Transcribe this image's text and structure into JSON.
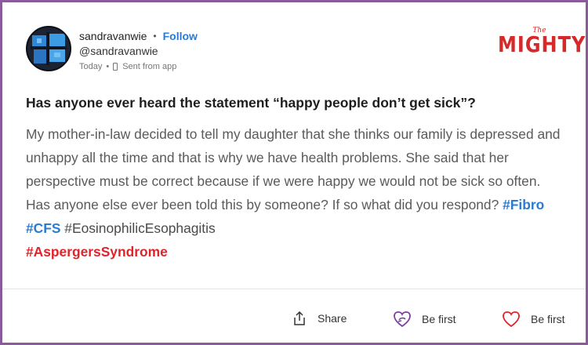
{
  "author": {
    "username": "sandravanwie",
    "follow_label": "Follow",
    "handle": "@sandravanwie",
    "time": "Today",
    "source": "Sent from app"
  },
  "brand": {
    "small": "The",
    "big": "MIGHTY",
    "color": "#d62a2a"
  },
  "post": {
    "title": "Has anyone ever heard the statement “happy people don’t get sick”?",
    "body": "My mother-in-law decided to tell my daughter that she thinks our family is depressed and unhappy all the time and that is why we have health problems. She said that her perspective must be correct because if we were happy we would not be sick so often. Has anyone else ever been told this by someone? If so what did you respond? ",
    "tags": [
      {
        "text": "#Fibro",
        "color": "#2a7bd1"
      },
      {
        "text": "#CFS",
        "color": "#2a7bd1"
      },
      {
        "text": "#EosinophilicEsophagitis",
        "color": "#4a4a4a"
      },
      {
        "text": "#AspergersSyndrome",
        "color": "#e2232a"
      }
    ]
  },
  "actions": {
    "share_label": "Share",
    "hug_label": "Be first",
    "like_label": "Be first"
  },
  "colors": {
    "frame": "#8b5a9a",
    "link": "#2a7bd1",
    "accent_purple": "#7b3fa0",
    "accent_red": "#e2232a"
  }
}
